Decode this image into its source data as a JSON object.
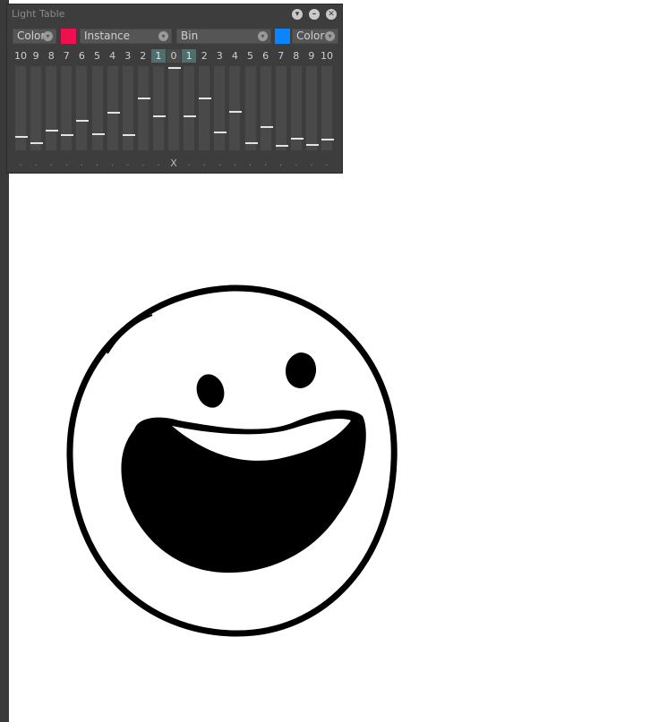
{
  "window": {
    "title": "Light Table",
    "buttons": [
      "chevron-down-icon",
      "minimize-icon",
      "close-icon"
    ]
  },
  "controls": {
    "left_mode": "Color",
    "left_swatch_color": "#f0104f",
    "left_select": "Instance",
    "right_select": "Bin",
    "right_swatch_color": "#0a84ff",
    "right_mode": "Color"
  },
  "numbers": [
    "10",
    "9",
    "8",
    "7",
    "6",
    "5",
    "4",
    "3",
    "2",
    "1",
    "0",
    "1",
    "2",
    "3",
    "4",
    "5",
    "6",
    "7",
    "8",
    "9",
    "10"
  ],
  "slider_levels": [
    0.15,
    0.08,
    0.23,
    0.17,
    0.35,
    0.19,
    0.45,
    0.17,
    0.62,
    0.4,
    0.99,
    0.4,
    0.62,
    0.21,
    0.46,
    0.08,
    0.27,
    0.04,
    0.13,
    0.05,
    0.12
  ],
  "dots": [
    ".",
    ".",
    ".",
    ".",
    ".",
    ".",
    ".",
    ".",
    ".",
    ".",
    "X",
    ".",
    ".",
    ".",
    ".",
    ".",
    ".",
    ".",
    ".",
    ".",
    "."
  ],
  "canvas": {
    "illustration": "laughing-face-drawing"
  }
}
